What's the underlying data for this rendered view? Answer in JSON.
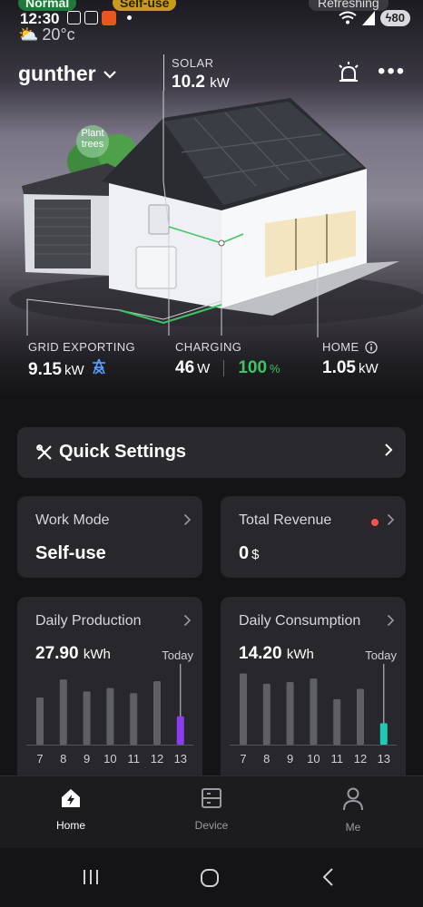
{
  "status_bar": {
    "pill_mode": "Normal",
    "pill_work": "Self-use",
    "pill_refresh": "Refreshing",
    "time": "12:30",
    "weather": "20°c",
    "battery": "80"
  },
  "header": {
    "site_name": "gunther",
    "solar_label": "SOLAR",
    "solar_value": "10.2",
    "solar_unit": "kW",
    "plant_trees": "Plant trees"
  },
  "flows": {
    "grid": {
      "label": "GRID EXPORTING",
      "value": "9.15",
      "unit": "kW"
    },
    "charging": {
      "label": "CHARGING",
      "value": "46",
      "unit": "W",
      "percent": "100",
      "percent_unit": "%"
    },
    "home": {
      "label": "HOME",
      "value": "1.05",
      "unit": "kW"
    }
  },
  "quick_settings": {
    "title": "Quick Settings"
  },
  "work_mode": {
    "title": "Work Mode",
    "value": "Self-use"
  },
  "total_revenue": {
    "title": "Total Revenue",
    "value": "0",
    "unit": "$"
  },
  "daily_production": {
    "title": "Daily Production",
    "value": "27.90",
    "unit": "kWh",
    "today_label": "Today",
    "accent": "#8a3df0"
  },
  "daily_consumption": {
    "title": "Daily Consumption",
    "value": "14.20",
    "unit": "kWh",
    "today_label": "Today",
    "accent": "#1fc9b4"
  },
  "chart_data": [
    {
      "type": "bar",
      "title": "Daily Production",
      "categories": [
        "7",
        "8",
        "9",
        "10",
        "11",
        "12",
        "13"
      ],
      "values": [
        27.5,
        38,
        31,
        33,
        30,
        37,
        16.5
      ],
      "ylim": [
        0,
        46
      ],
      "highlight_last": true
    },
    {
      "type": "bar",
      "title": "Daily Consumption",
      "categories": [
        "7",
        "8",
        "9",
        "10",
        "11",
        "12",
        "13"
      ],
      "values": [
        41.5,
        35.5,
        36.5,
        38.5,
        26.5,
        32.5,
        12.5
      ],
      "ylim": [
        0,
        46
      ],
      "highlight_last": true
    }
  ],
  "tabs": [
    {
      "label": "Home",
      "icon": "home-bolt-icon",
      "active": true
    },
    {
      "label": "Device",
      "icon": "device-icon",
      "active": false
    },
    {
      "label": "Me",
      "icon": "person-icon",
      "active": false
    }
  ],
  "colors": {
    "green": "#3cc563",
    "link_blue": "#5aa0ff",
    "card_bg": "#28282c"
  }
}
